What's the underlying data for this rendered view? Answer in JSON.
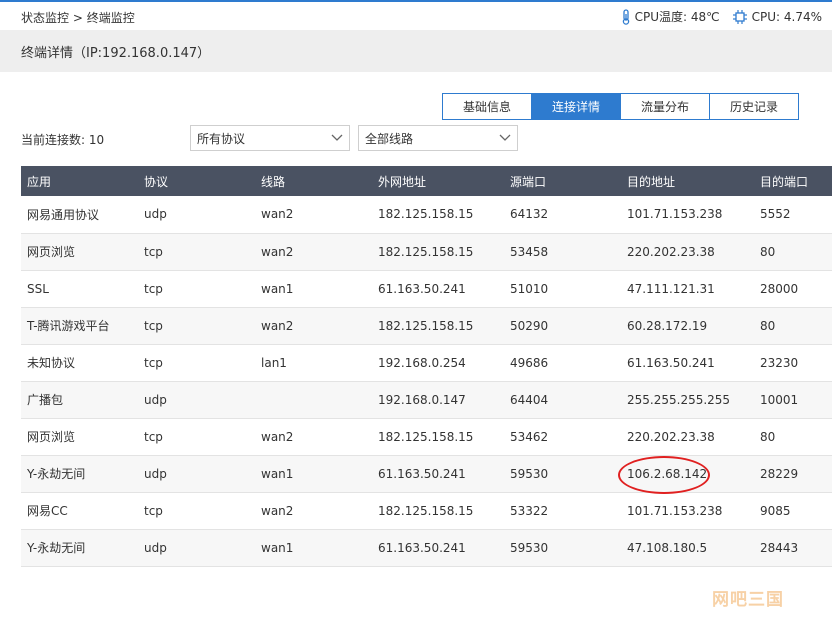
{
  "breadcrumb": {
    "parent": "状态监控",
    "separator": " > ",
    "current": "终端监控"
  },
  "status": {
    "cpu_temp_label": "CPU温度: 48℃",
    "cpu_usage_label": "CPU: 4.74%"
  },
  "page_title": "终端详情（IP:192.168.0.147）",
  "tabs": [
    {
      "label": "基础信息",
      "active": false
    },
    {
      "label": "连接详情",
      "active": true
    },
    {
      "label": "流量分布",
      "active": false
    },
    {
      "label": "历史记录",
      "active": false
    }
  ],
  "filters": {
    "conn_count_label": "当前连接数: 10",
    "protocol_select": "所有协议",
    "line_select": "全部线路"
  },
  "table": {
    "headers": [
      "应用",
      "协议",
      "线路",
      "外网地址",
      "源端口",
      "目的地址",
      "目的端口"
    ],
    "rows": [
      [
        "网易通用协议",
        "udp",
        "wan2",
        "182.125.158.15",
        "64132",
        "101.71.153.238",
        "5552"
      ],
      [
        "网页浏览",
        "tcp",
        "wan2",
        "182.125.158.15",
        "53458",
        "220.202.23.38",
        "80"
      ],
      [
        "SSL",
        "tcp",
        "wan1",
        "61.163.50.241",
        "51010",
        "47.111.121.31",
        "28000"
      ],
      [
        "T-腾讯游戏平台",
        "tcp",
        "wan2",
        "182.125.158.15",
        "50290",
        "60.28.172.19",
        "80"
      ],
      [
        "未知协议",
        "tcp",
        "lan1",
        "192.168.0.254",
        "49686",
        "61.163.50.241",
        "23230"
      ],
      [
        "广播包",
        "udp",
        "",
        "192.168.0.147",
        "64404",
        "255.255.255.255",
        "10001"
      ],
      [
        "网页浏览",
        "tcp",
        "wan2",
        "182.125.158.15",
        "53462",
        "220.202.23.38",
        "80"
      ],
      [
        "Y-永劫无间",
        "udp",
        "wan1",
        "61.163.50.241",
        "59530",
        "106.2.68.142",
        "28229"
      ],
      [
        "网易CC",
        "tcp",
        "wan2",
        "182.125.158.15",
        "53322",
        "101.71.153.238",
        "9085"
      ],
      [
        "Y-永劫无间",
        "udp",
        "wan1",
        "61.163.50.241",
        "59530",
        "47.108.180.5",
        "28443"
      ]
    ]
  },
  "watermark": "网吧三国",
  "colors": {
    "accent": "#2e7bcf",
    "header_bg": "#4a5262",
    "highlight": "#e02020"
  }
}
